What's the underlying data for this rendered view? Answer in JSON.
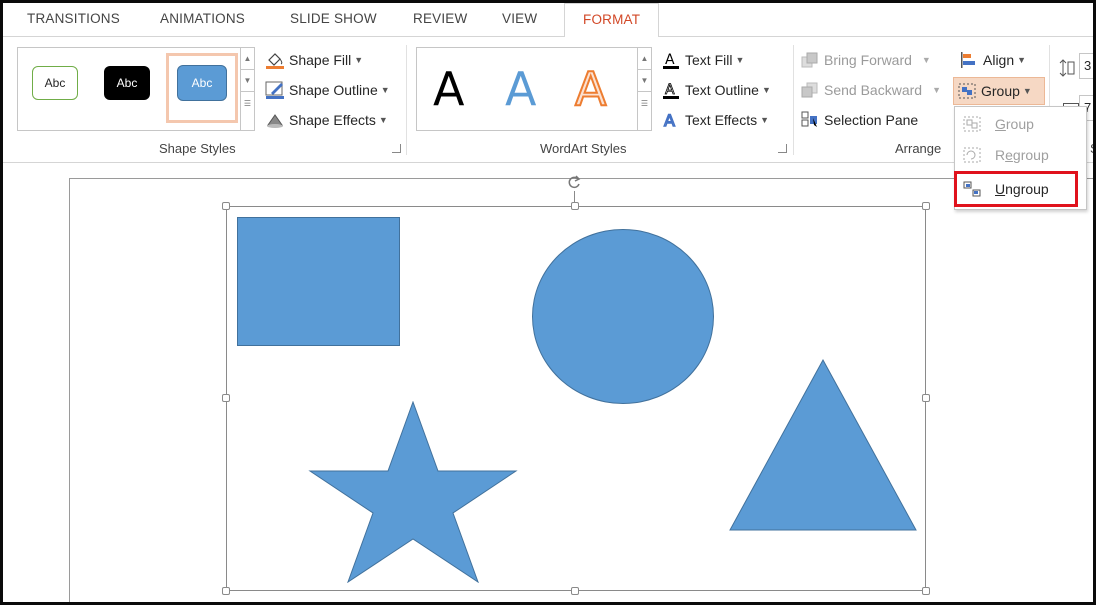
{
  "tabs": [
    {
      "label": "TRANSITIONS"
    },
    {
      "label": "ANIMATIONS"
    },
    {
      "label": "SLIDE SHOW"
    },
    {
      "label": "REVIEW"
    },
    {
      "label": "VIEW"
    },
    {
      "label": "FORMAT",
      "active": true
    }
  ],
  "shape_styles": {
    "group_label": "Shape Styles",
    "presets": [
      "Abc",
      "Abc",
      "Abc"
    ],
    "fill": "Shape Fill",
    "outline": "Shape Outline",
    "effects": "Shape Effects"
  },
  "wordart_styles": {
    "group_label": "WordArt Styles",
    "letters": [
      "A",
      "A",
      "A"
    ],
    "fill": "Text Fill",
    "outline": "Text Outline",
    "effects": "Text Effects"
  },
  "arrange": {
    "group_label": "Arrange",
    "bring_forward": "Bring Forward",
    "send_backward": "Send Backward",
    "selection_pane": "Selection Pane",
    "align": "Align",
    "group": "Group"
  },
  "size_partial": [
    "3",
    "7"
  ],
  "group_menu": {
    "group": {
      "pre": "",
      "ul": "G",
      "post": "roup"
    },
    "regroup": {
      "pre": "R",
      "ul": "e",
      "post": "group"
    },
    "ungroup": {
      "pre": "",
      "ul": "U",
      "post": "ngroup"
    }
  },
  "colors": {
    "accent": "#d24726",
    "shape_fill": "#5b9bd5",
    "shape_stroke": "#41719c",
    "highlight": "#e0121c"
  }
}
